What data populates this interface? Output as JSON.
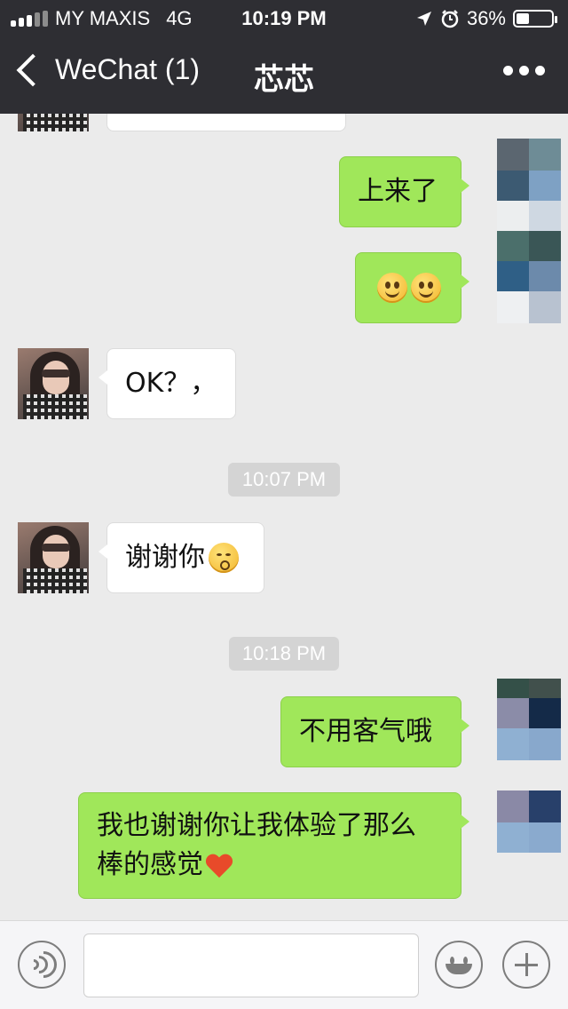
{
  "status_bar": {
    "carrier": "MY MAXIS",
    "network": "4G",
    "time": "10:19 PM",
    "battery": "36%",
    "battery_level": 0.36,
    "icons": [
      "signal-icon",
      "location-arrow-icon",
      "alarm-icon",
      "battery-icon"
    ]
  },
  "nav": {
    "back_label": "WeChat (1)",
    "title": "芯芯",
    "more_icon": "more-dots-icon"
  },
  "messages": [
    {
      "from": "me",
      "text": "上来了"
    },
    {
      "from": "me",
      "text": "",
      "emoji": [
        "smile-emoji",
        "smile-emoji"
      ]
    },
    {
      "from": "them",
      "text": "OK？，"
    },
    {
      "type": "time",
      "text": "10:07 PM"
    },
    {
      "from": "them",
      "text": "谢谢你",
      "emoji": [
        "kiss-emoji"
      ]
    },
    {
      "type": "time",
      "text": "10:18 PM"
    },
    {
      "from": "me",
      "text": "不用客气哦"
    },
    {
      "from": "me",
      "text_line1": "我也谢谢你让我体验了那么",
      "text_line2": "棒的感觉",
      "emoji": [
        "heart-emoji"
      ]
    }
  ],
  "input_bar": {
    "value": "",
    "icons": [
      "voice-icon",
      "emoji-icon",
      "plus-icon"
    ]
  },
  "colors": {
    "nav_bg": "#2e2e33",
    "chat_bg": "#ebebeb",
    "my_bubble": "#a0e75a",
    "their_bubble": "#ffffff",
    "time_chip": "#d4d4d4"
  }
}
